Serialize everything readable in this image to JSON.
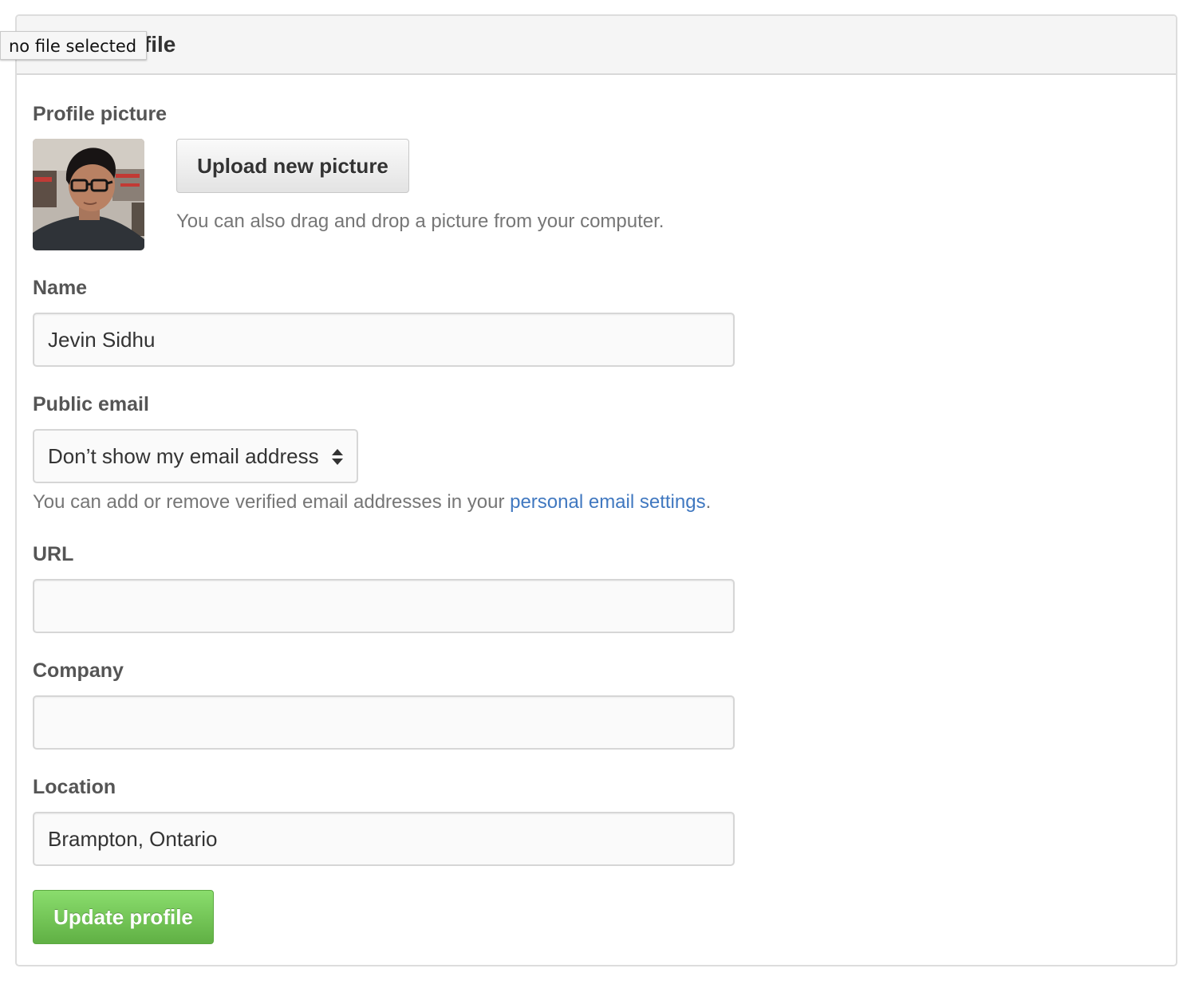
{
  "tooltip": {
    "text": "no file selected"
  },
  "panel": {
    "title": "Public profile"
  },
  "profile_picture": {
    "label": "Profile picture",
    "upload_button": "Upload new picture",
    "hint": "You can also drag and drop a picture from your computer."
  },
  "name": {
    "label": "Name",
    "value": "Jevin Sidhu",
    "placeholder": ""
  },
  "public_email": {
    "label": "Public email",
    "selected": "Don’t show my email address",
    "hint_prefix": "You can add or remove verified email addresses in your ",
    "hint_link": "personal email settings",
    "hint_suffix": "."
  },
  "url": {
    "label": "URL",
    "value": "",
    "placeholder": ""
  },
  "company": {
    "label": "Company",
    "value": "",
    "placeholder": ""
  },
  "location": {
    "label": "Location",
    "value": "Brampton, Ontario",
    "placeholder": ""
  },
  "submit": {
    "label": "Update profile"
  },
  "colors": {
    "link": "#4078c0",
    "primary_button": "#6cc644",
    "label_text": "#555555",
    "header_bg": "#f5f5f5"
  }
}
